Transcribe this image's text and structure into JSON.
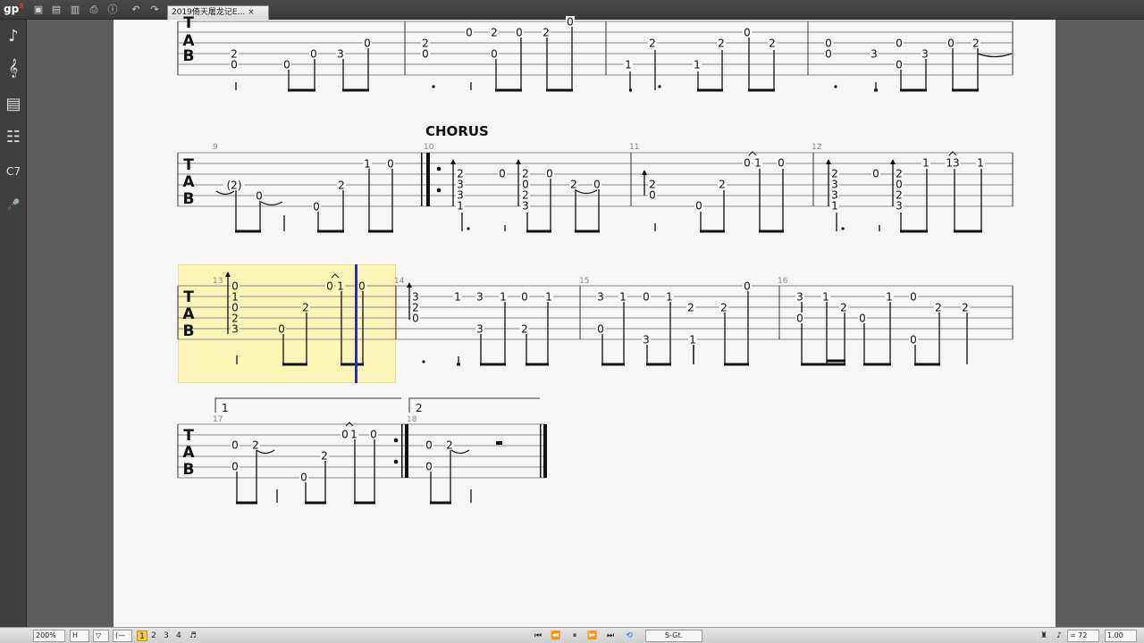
{
  "app": {
    "logo": "gp",
    "logo_version": "5"
  },
  "tab": {
    "title": "2019倚天屠龙记E...",
    "close": "×"
  },
  "toolbar": {
    "icons": [
      "new-file-icon",
      "open-file-icon",
      "save-icon",
      "print-icon",
      "info-icon",
      "undo-icon",
      "redo-icon"
    ]
  },
  "left_panel": {
    "items": [
      {
        "name": "note-icon",
        "glyph": "♪"
      },
      {
        "name": "guitar-icon",
        "glyph": "𝄞"
      },
      {
        "name": "amp-icon",
        "glyph": "▤"
      },
      {
        "name": "mixer-icon",
        "glyph": "☷"
      },
      {
        "name": "chord-icon",
        "glyph": "C7"
      },
      {
        "name": "microphone-icon",
        "glyph": "🎤"
      }
    ]
  },
  "score": {
    "section_label": "CHORUS",
    "tab_letters": [
      "T",
      "A",
      "B"
    ],
    "bar_numbers": [
      "9",
      "10",
      "11",
      "12",
      "13",
      "14",
      "15",
      "16",
      "17",
      "18"
    ],
    "volta_1": "1",
    "volta_2": "2",
    "rows": [
      {
        "notes": [
          [
            "2",
            262,
            60
          ],
          [
            "0",
            262,
            72
          ],
          [
            "0",
            321,
            72
          ],
          [
            "0",
            351,
            60
          ],
          [
            "3",
            381,
            60
          ],
          [
            "0",
            411,
            48
          ],
          [
            "2",
            476,
            48
          ],
          [
            "0",
            476,
            60
          ],
          [
            "0",
            525,
            36
          ],
          [
            "2",
            553,
            36
          ],
          [
            "0",
            553,
            60
          ],
          [
            "0",
            581,
            36
          ],
          [
            "2",
            611,
            36
          ],
          [
            "0",
            638,
            24
          ],
          [
            "1",
            703,
            72
          ],
          [
            "2",
            730,
            48
          ],
          [
            "1",
            780,
            72
          ],
          [
            "2",
            807,
            48
          ],
          [
            "0",
            836,
            36
          ],
          [
            "2",
            864,
            48
          ],
          [
            "0",
            927,
            48
          ],
          [
            "0",
            927,
            60
          ],
          [
            "3",
            978,
            60
          ],
          [
            "0",
            1006,
            48
          ],
          [
            "0",
            1006,
            72
          ],
          [
            "3",
            1035,
            60
          ],
          [
            "0",
            1064,
            48
          ],
          [
            "2",
            1092,
            48
          ]
        ]
      },
      {
        "notes": [
          [
            "(2)",
            262,
            207
          ],
          [
            "0",
            290,
            219
          ],
          [
            "0",
            354,
            231
          ],
          [
            "2",
            382,
            207
          ],
          [
            "1",
            411,
            183
          ],
          [
            "0",
            437,
            183
          ],
          [
            "2",
            515,
            194
          ],
          [
            "3",
            515,
            206
          ],
          [
            "3",
            515,
            218
          ],
          [
            "1",
            515,
            230
          ],
          [
            "0",
            562,
            194
          ],
          [
            "2",
            588,
            194
          ],
          [
            "0",
            588,
            206
          ],
          [
            "2",
            588,
            218
          ],
          [
            "3",
            588,
            230
          ],
          [
            "0",
            615,
            194
          ],
          [
            "2",
            642,
            206
          ],
          [
            "0",
            668,
            206
          ],
          [
            "2",
            730,
            206
          ],
          [
            "0",
            730,
            218
          ],
          [
            "0",
            782,
            230
          ],
          [
            "2",
            808,
            206
          ],
          [
            "0",
            836,
            182
          ],
          [
            "1",
            848,
            182
          ],
          [
            "0",
            874,
            182
          ],
          [
            "2",
            934,
            194
          ],
          [
            "3",
            934,
            206
          ],
          [
            "3",
            934,
            218
          ],
          [
            "1",
            934,
            230
          ],
          [
            "0",
            980,
            194
          ],
          [
            "2",
            1006,
            194
          ],
          [
            "0",
            1006,
            206
          ],
          [
            "2",
            1006,
            218
          ],
          [
            "3",
            1006,
            230
          ],
          [
            "1",
            1036,
            182
          ],
          [
            "13",
            1066,
            182
          ],
          [
            "1",
            1097,
            182
          ]
        ]
      },
      {
        "notes": [
          [
            "0",
            263,
            320
          ],
          [
            "1",
            263,
            332
          ],
          [
            "0",
            263,
            344
          ],
          [
            "2",
            263,
            356
          ],
          [
            "3",
            263,
            368
          ],
          [
            "0",
            315,
            368
          ],
          [
            "2",
            342,
            344
          ],
          [
            "0",
            369,
            320
          ],
          [
            "1",
            381,
            320
          ],
          [
            "0",
            405,
            320
          ],
          [
            "3",
            465,
            332
          ],
          [
            "2",
            465,
            344
          ],
          [
            "0",
            465,
            356
          ],
          [
            "1",
            512,
            332
          ],
          [
            "3",
            537,
            332
          ],
          [
            "3",
            537,
            368
          ],
          [
            "1",
            563,
            332
          ],
          [
            "2",
            587,
            368
          ],
          [
            "0",
            587,
            332
          ],
          [
            "1",
            614,
            332
          ],
          [
            "3",
            672,
            332
          ],
          [
            "0",
            672,
            368
          ],
          [
            "1",
            697,
            332
          ],
          [
            "0",
            723,
            332
          ],
          [
            "3",
            723,
            380
          ],
          [
            "1",
            749,
            332
          ],
          [
            "1",
            775,
            380
          ],
          [
            "2",
            773,
            344
          ],
          [
            "2",
            810,
            344
          ],
          [
            "0",
            836,
            320
          ],
          [
            "3",
            895,
            332
          ],
          [
            "0",
            895,
            356
          ],
          [
            "1",
            924,
            332
          ],
          [
            "2",
            944,
            344
          ],
          [
            "0",
            965,
            356
          ],
          [
            "1",
            995,
            332
          ],
          [
            "0",
            1022,
            332
          ],
          [
            "0",
            1022,
            380
          ],
          [
            "2",
            1050,
            344
          ],
          [
            "2",
            1080,
            344
          ]
        ]
      },
      {
        "notes": [
          [
            "0",
            263,
            498
          ],
          [
            "2",
            286,
            498
          ],
          [
            "0",
            263,
            522
          ],
          [
            "0",
            340,
            534
          ],
          [
            "2",
            363,
            510
          ],
          [
            "0",
            386,
            486
          ],
          [
            "1",
            396,
            486
          ],
          [
            "0",
            418,
            486
          ],
          [
            "0",
            480,
            498
          ],
          [
            "2",
            503,
            498
          ],
          [
            "0",
            480,
            522
          ]
        ]
      }
    ]
  },
  "statusbar": {
    "zoom": "200%",
    "layout": "H",
    "view": "▽",
    "track_sel": "(—",
    "voices": [
      "1",
      "2",
      "3",
      "4"
    ],
    "track": "S-Gt.",
    "tempo": "= 72",
    "speed": "1.00"
  }
}
